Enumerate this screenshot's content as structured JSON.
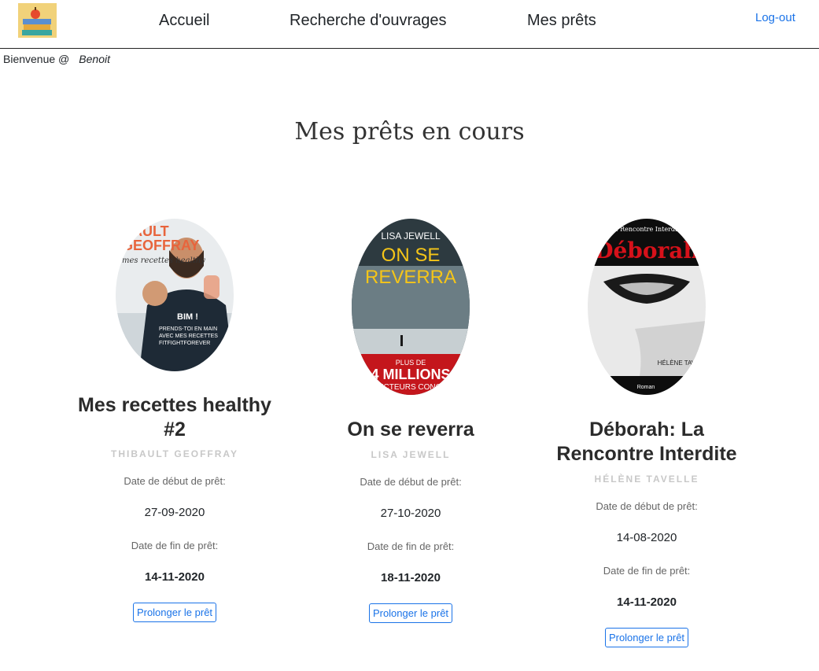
{
  "nav": {
    "home": "Accueil",
    "search": "Recherche d'ouvrages",
    "loans": "Mes prêts",
    "logout": "Log-out"
  },
  "welcome": {
    "prefix": "Bienvenue @",
    "user": "Benoit"
  },
  "page_title": "Mes prêts en cours",
  "labels": {
    "start": "Date de début de prêt:",
    "end": "Date de fin de prêt:",
    "extend": "Prolonger le prêt"
  },
  "loans": [
    {
      "title": "Mes recettes healthy #2",
      "author": "Thibault Geoffray",
      "start": "27-09-2020",
      "end": "14-11-2020",
      "cover_text": [
        "BAULT",
        "GEOFFRAY",
        "mes recettes healthy",
        "BIM !",
        "PRENDS-TOI EN MAIN",
        "AVEC MES RECETTES",
        "FITFIGHTFOREVER"
      ]
    },
    {
      "title": "On se reverra",
      "author": "Lisa Jewell",
      "start": "27-10-2020",
      "end": "18-11-2020",
      "cover_text": [
        "LISA JEWELL",
        "ON SE",
        "REVERRA",
        "PLUS DE",
        "4 MILLIONS",
        "LECTEURS CONQU"
      ]
    },
    {
      "title": "Déborah: La Rencontre Interdite",
      "author": "Hélène Tavelle",
      "start": "14-08-2020",
      "end": "14-11-2020",
      "cover_text": [
        "La Rencontre Interdite",
        "Déborah",
        "HÉLÈNE TAVELL",
        "Roman"
      ]
    }
  ]
}
